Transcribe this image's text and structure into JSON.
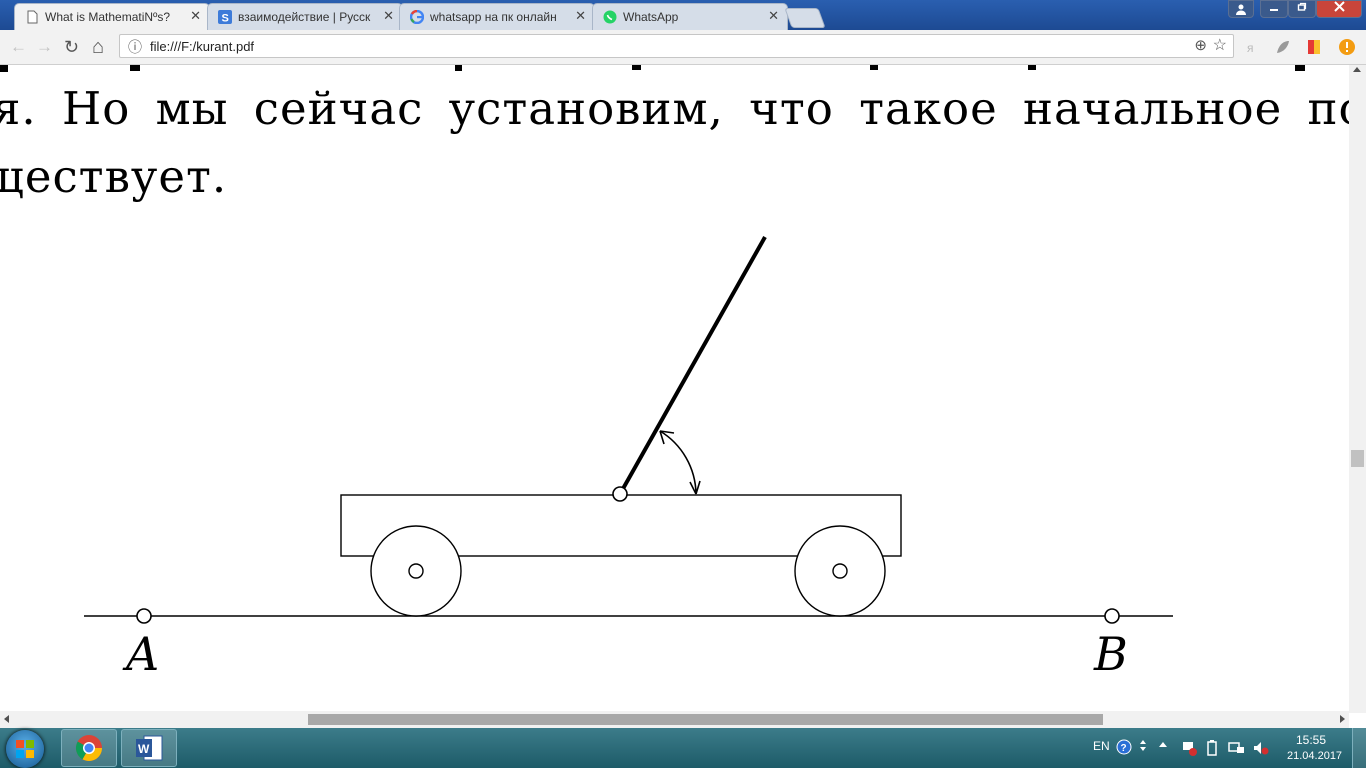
{
  "tabs": [
    {
      "label": "What is MathematiNºs?",
      "icon": "document-icon",
      "active": true
    },
    {
      "label": "взаимодействие | Русск",
      "icon": "s-icon",
      "active": false
    },
    {
      "label": "whatsapp на пк онлайн",
      "icon": "google-icon",
      "active": false
    },
    {
      "label": "WhatsApp",
      "icon": "whatsapp-icon",
      "active": false
    }
  ],
  "tab_close": "✕",
  "toolbar": {
    "url": "file:///F:/kurant.pdf",
    "back": "←",
    "forward": "→",
    "reload": "↻",
    "home": "⌂",
    "info": "ⓘ",
    "zoom": "⊕",
    "star": "☆"
  },
  "pdf": {
    "line1": "я. Но мы сейчас установим, что такое начальное поло",
    "line2": "ществует.",
    "figure": {
      "label_a": "A",
      "label_b": "B"
    }
  },
  "taskbar": {
    "lang": "EN",
    "time": "15:55",
    "date": "21.04.2017"
  }
}
